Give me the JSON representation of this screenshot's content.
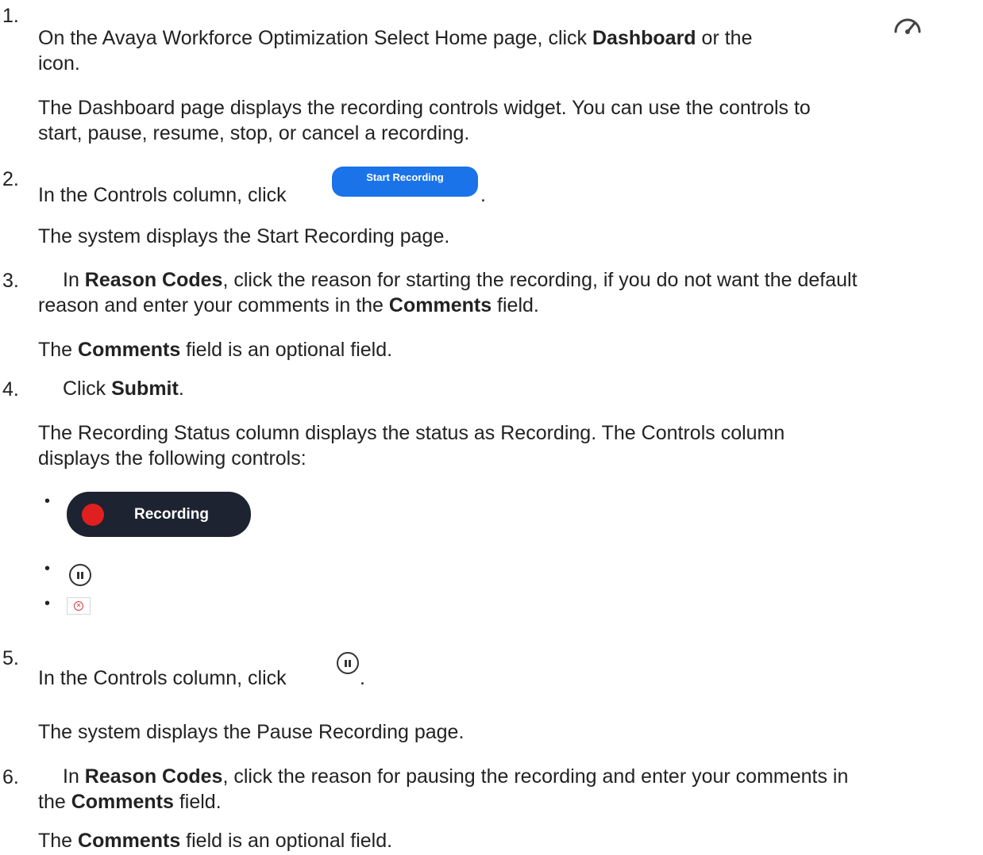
{
  "steps": {
    "s1": {
      "number": "1.",
      "prefix": "On the Avaya Workforce Optimization Select Home page, click ",
      "bold": "Dashboard",
      "mid": " or the",
      "line2": "icon.",
      "icon": "dashboard-gauge-icon",
      "result_line1": "The Dashboard page displays the recording controls widget. You can use the controls to",
      "result_line2": "start, pause, resume, stop, or cancel a recording."
    },
    "s2": {
      "number": "2.",
      "prefix": "In the Controls column, click",
      "button_label": "Start Recording",
      "suffix": ".",
      "result": "The system displays the Start Recording page."
    },
    "s3": {
      "number": "3.",
      "prefix": "In ",
      "bold1": "Reason Codes",
      "mid": ", click the reason for starting the recording, if you do not want the default",
      "line2_prefix": "reason and enter your comments in the ",
      "bold2": "Comments",
      "line2_suffix": " field.",
      "note_prefix": "The ",
      "note_bold": "Comments",
      "note_suffix": " field is an optional field."
    },
    "s4": {
      "number": "4.",
      "prefix": "Click ",
      "bold": "Submit",
      "suffix": ".",
      "result_line1": "The Recording Status column displays the status as Recording. The Controls column",
      "result_line2": "displays the following controls:",
      "bullet": "•",
      "recording_label": "Recording",
      "pause_icon": "pause-circle-icon",
      "cancel_icon": "cancel-circle-icon",
      "recording_dot_color": "#e02020"
    },
    "s5": {
      "number": "5.",
      "prefix": "In the Controls column, click",
      "suffix": ".",
      "result": "The system displays the Pause Recording page."
    },
    "s6": {
      "number": "6.",
      "prefix": "In ",
      "bold1": "Reason Codes",
      "mid": ", click the reason for pausing the recording and enter your comments in",
      "line2_prefix": "the ",
      "bold2": "Comments",
      "line2_suffix": " field.",
      "note_prefix": "The ",
      "note_bold": "Comments",
      "note_suffix": " field is an optional field."
    }
  },
  "colors": {
    "start_button": "#1a73e8",
    "recording_pill": "#1d2330",
    "cancel_icon": "#d23a3a"
  }
}
